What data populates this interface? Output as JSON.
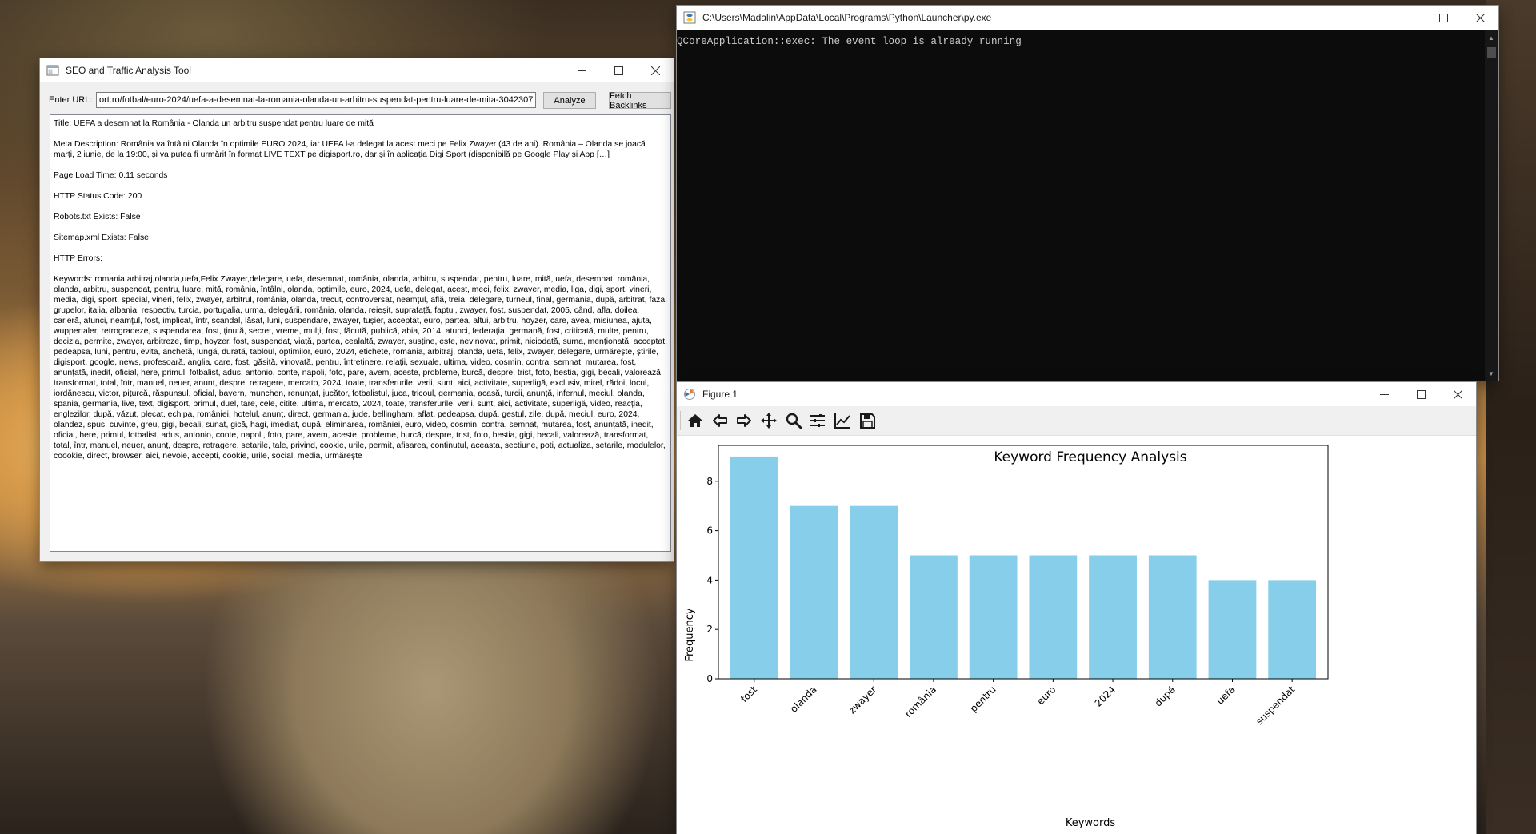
{
  "seo_window": {
    "title": "SEO and Traffic Analysis Tool",
    "url_label": "Enter URL:",
    "url_value": "ort.ro/fotbal/euro-2024/uefa-a-desemnat-la-romania-olanda-un-arbitru-suspendat-pentru-luare-de-mita-3042307",
    "analyze_label": "Analyze",
    "backlinks_label": "Fetch Backlinks",
    "results": {
      "title_line": "Title: UEFA a desemnat la România - Olanda un arbitru suspendat pentru luare de mită",
      "meta_line": "Meta Description: România va întâlni Olanda în optimile EURO 2024, iar UEFA l-a delegat la acest meci pe Felix Zwayer (43 de ani).  România – Olanda se joacă marți, 2 iunie, de la 19:00, și va putea fi urmărit în format LIVE TEXT pe digisport.ro, dar și în aplicația Digi Sport (disponibilă pe Google Play și App […]",
      "load_time_line": "Page Load Time: 0.11 seconds",
      "status_line": "HTTP Status Code: 200",
      "robots_line": "Robots.txt Exists: False",
      "sitemap_line": "Sitemap.xml Exists: False",
      "errors_line": "HTTP Errors:",
      "keywords_line": "Keywords: romania,arbitraj,olanda,uefa,Felix Zwayer,delegare, uefa, desemnat, românia, olanda, arbitru, suspendat, pentru, luare, mită, uefa, desemnat, românia, olanda, arbitru, suspendat, pentru, luare, mită, românia, întâlni, olanda, optimile, euro, 2024, uefa, delegat, acest, meci, felix, zwayer, media, liga, digi, sport, vineri, media, digi, sport, special, vineri, felix, zwayer, arbitrul, românia, olanda, trecut, controversat, neamțul, află, treia, delegare, turneul, final, germania, după, arbitrat, faza, grupelor, italia, albania, respectiv, turcia, portugalia, urma, delegării, românia, olanda, reieșit, suprafață, faptul, zwayer, fost, suspendat, 2005, când, afla, doilea, carieră, atunci, neamțul, fost, implicat, într, scandal, lăsat, luni, suspendare, zwayer, tușier, acceptat, euro, partea, altui, arbitru, hoyzer, care, avea, misiunea, ajuta, wuppertaler, retrogradeze, suspendarea, fost, ținută, secret, vreme, mulți, fost, făcută, publică, abia, 2014, atunci, federația, germană, fost, criticată, multe, pentru, decizia, permite, zwayer, arbitreze, timp, hoyzer, fost, suspendat, viață, partea, cealaltă, zwayer, susține, este, nevinovat, primit, niciodată, suma, menționată, acceptat, pedeapsa, luni, pentru, evita, anchetă, lungă, durată, tabloul, optimilor, euro, 2024, etichete, romania, arbitraj, olanda, uefa, felix, zwayer, delegare, urmărește, știrile, digisport, google, news, profesoară, anglia, care, fost, găsită, vinovată, pentru, întreținere, relații, sexuale, ultima, video, cosmin, contra, semnat, mutarea, fost, anunțată, inedit, oficial, here, primul, fotbalist, adus, antonio, conte, napoli, foto, pare, avem, aceste, probleme, burcă, despre, trist, foto, bestia, gigi, becali, valorează, transformat, total, într, manuel, neuer, anunț, despre, retragere, mercato, 2024, toate, transferurile, verii, sunt, aici, activitate, superligă, exclusiv, mirel, rădoi, locul, iordănescu, victor, pițurcă, răspunsul, oficial, bayern, munchen, renunțat, jucător, fotbalistul, juca, tricoul, germania, acasă, turcii, anunță, infernul, meciul, olanda, spania, germania, live, text, digisport, primul, duel, tare, cele, citite, ultima, mercato, 2024, toate, transferurile, verii, sunt, aici, activitate, superligă, video, reacția, englezilor, după, văzut, plecat, echipa, româniei, hotelul, anunț, direct, germania, jude, bellingham, aflat, pedeapsa, după, gestul, zile, după, meciul, euro, 2024, olandez, spus, cuvinte, greu, gigi, becali, sunat, gică, hagi, imediat, după, eliminarea, româniei, euro, video, cosmin, contra, semnat, mutarea, fost, anunțată, inedit, oficial, here, primul, fotbalist, adus, antonio, conte, napoli, foto, pare, avem, aceste, probleme, burcă, despre, trist, foto, bestia, gigi, becali, valorează, transformat, total, într, manuel, neuer, anunț, despre, retragere, setarile, tale, privind, cookie, urile, permit, afisarea, continutul, aceasta, sectiune, poti, actualiza, setarile, modulelor, coookie, direct, browser, aici, nevoie, accepti, cookie, urile, social, media, urmărește"
    }
  },
  "console_window": {
    "title": "C:\\Users\\Madalin\\AppData\\Local\\Programs\\Python\\Launcher\\py.exe",
    "output": "QCoreApplication::exec: The event loop is already running"
  },
  "figure_window": {
    "title": "Figure 1",
    "toolbar": [
      "home-icon",
      "back-arrow-icon",
      "forward-arrow-icon",
      "pan-icon",
      "zoom-icon",
      "subplots-icon",
      "edit-axis-icon",
      "save-icon"
    ]
  },
  "chart_data": {
    "type": "bar",
    "title": "Keyword Frequency Analysis",
    "xlabel": "Keywords",
    "ylabel": "Frequency",
    "categories": [
      "fost",
      "olanda",
      "zwayer",
      "românia",
      "pentru",
      "euro",
      "2024",
      "după",
      "uefa",
      "suspendat"
    ],
    "values": [
      9,
      7,
      7,
      5,
      5,
      5,
      5,
      5,
      4,
      4
    ],
    "ylim": [
      0,
      9.45
    ],
    "yticks": [
      0,
      2,
      4,
      6,
      8
    ],
    "bar_color": "#87ceeb",
    "grid": false
  }
}
